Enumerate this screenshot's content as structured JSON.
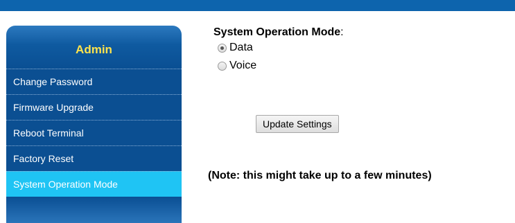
{
  "sidebar": {
    "title": "Admin",
    "items": [
      {
        "label": "Change Password"
      },
      {
        "label": "Firmware Upgrade"
      },
      {
        "label": "Reboot Terminal"
      },
      {
        "label": "Factory Reset"
      },
      {
        "label": "System Operation Mode",
        "active": true
      }
    ]
  },
  "main": {
    "heading": "System Operation Mode",
    "heading_colon": ":",
    "options": [
      {
        "label": "Data",
        "selected": true
      },
      {
        "label": "Voice",
        "selected": false
      }
    ],
    "update_button_label": "Update Settings",
    "note": "(Note: this might take up to a few minutes)"
  },
  "colors": {
    "top_bar": "#0d64ad",
    "sidebar_bg": "#0b4f92",
    "sidebar_active": "#1fc4f4",
    "sidebar_title": "#ffe34d"
  }
}
